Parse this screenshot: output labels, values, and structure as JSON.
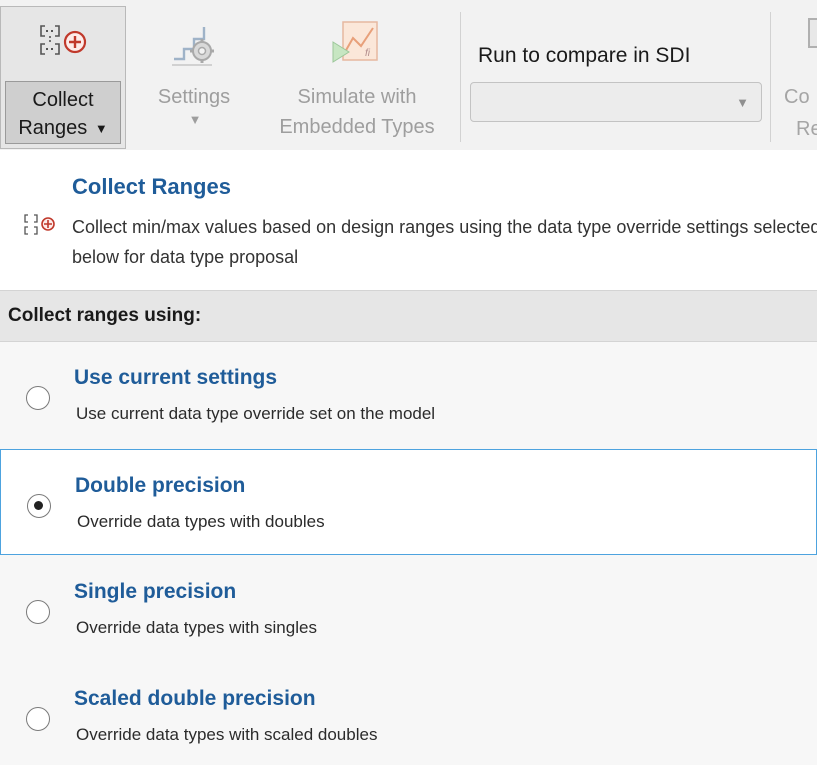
{
  "toolstrip": {
    "collect_ranges": {
      "line1": "Collect",
      "line2": "Ranges",
      "caret": "▼"
    },
    "settings": {
      "label": "Settings",
      "caret": "▼"
    },
    "simulate": {
      "line1": "Simulate with",
      "line2": "Embedded Types"
    },
    "run_compare": {
      "label": "Run to compare in SDI",
      "value": "",
      "arrow": "▼"
    },
    "cut_button": {
      "line1": "Co",
      "line2": "Re"
    }
  },
  "panel": {
    "title": "Collect Ranges",
    "description": "Collect min/max values based on design ranges using the data type override settings selected below for data type proposal",
    "section_header": "Collect ranges using:"
  },
  "options": [
    {
      "title": "Use current settings",
      "description": "Use current data type override set on the model",
      "selected": false
    },
    {
      "title": "Double precision",
      "description": "Override data types with doubles",
      "selected": true
    },
    {
      "title": "Single precision",
      "description": "Override data types with singles",
      "selected": false
    },
    {
      "title": "Scaled double precision",
      "description": "Override data types with scaled doubles",
      "selected": false
    }
  ],
  "colors": {
    "accent": "#1f5c99",
    "selection_border": "#4da3df",
    "plus_icon": "#c0392b"
  }
}
